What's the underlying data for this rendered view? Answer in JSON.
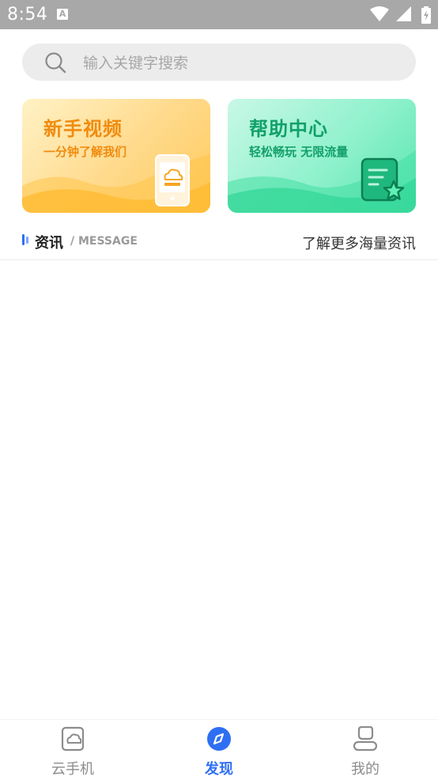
{
  "status_bar": {
    "time": "8:54",
    "notification_glyph": "A"
  },
  "search": {
    "placeholder": "输入关键字搜索"
  },
  "cards": [
    {
      "title": "新手视频",
      "subtitle": "一分钟了解我们",
      "icon": "phone-cloud-icon",
      "accent": "#f08c10"
    },
    {
      "title": "帮助中心",
      "subtitle": "轻松畅玩 无限流量",
      "icon": "document-star-icon",
      "accent": "#13a06a"
    }
  ],
  "news_section": {
    "title": "资讯",
    "subtitle": "/ MESSAGE",
    "more_link": "了解更多海量资讯"
  },
  "bottom_nav": {
    "items": [
      {
        "label": "云手机",
        "icon": "cloud-phone-icon",
        "active": false
      },
      {
        "label": "发现",
        "icon": "compass-icon",
        "active": true
      },
      {
        "label": "我的",
        "icon": "profile-icon",
        "active": false
      }
    ]
  },
  "colors": {
    "primary": "#2e6ff4",
    "status_bar": "#a8a8a8",
    "search_bg": "#ececec"
  }
}
